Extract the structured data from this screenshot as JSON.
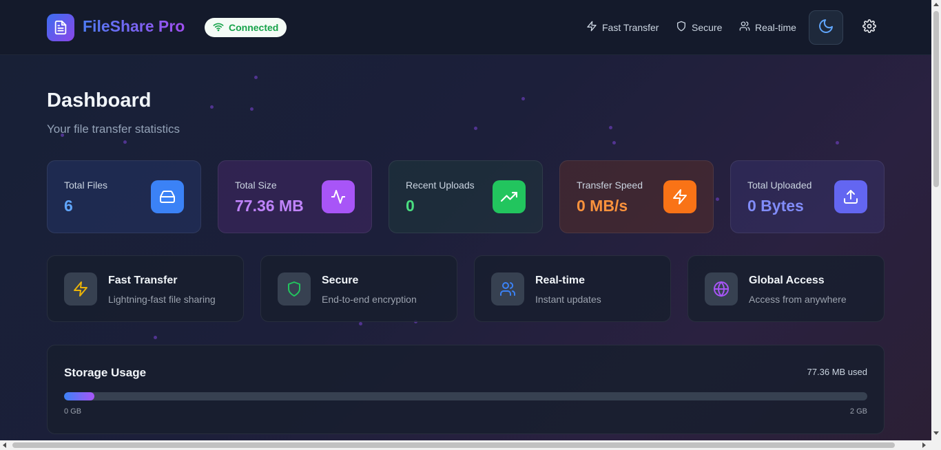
{
  "header": {
    "app_name": "FileShare Pro",
    "status": "Connected",
    "nav": [
      {
        "label": "Fast Transfer",
        "icon": "zap-icon"
      },
      {
        "label": "Secure",
        "icon": "shield-icon"
      },
      {
        "label": "Real-time",
        "icon": "users-icon"
      }
    ],
    "theme_icon": "moon-icon",
    "settings_icon": "gear-icon"
  },
  "page": {
    "title": "Dashboard",
    "subtitle": "Your file transfer statistics"
  },
  "stats": [
    {
      "label": "Total Files",
      "value": "6",
      "color": "#60a5fa",
      "icon": "hard-drive-icon"
    },
    {
      "label": "Total Size",
      "value": "77.36 MB",
      "color": "#c084fc",
      "icon": "activity-icon"
    },
    {
      "label": "Recent Uploads",
      "value": "0",
      "color": "#4ade80",
      "icon": "trending-up-icon"
    },
    {
      "label": "Transfer Speed",
      "value": "0 MB/s",
      "color": "#fb923c",
      "icon": "zap-icon"
    },
    {
      "label": "Total Uploaded",
      "value": "0 Bytes",
      "color": "#818cf8",
      "icon": "upload-icon"
    }
  ],
  "features": [
    {
      "title": "Fast Transfer",
      "subtitle": "Lightning-fast file sharing",
      "icon": "zap-icon"
    },
    {
      "title": "Secure",
      "subtitle": "End-to-end encryption",
      "icon": "shield-icon"
    },
    {
      "title": "Real-time",
      "subtitle": "Instant updates",
      "icon": "users-icon"
    },
    {
      "title": "Global Access",
      "subtitle": "Access from anywhere",
      "icon": "globe-icon"
    }
  ],
  "storage": {
    "title": "Storage Usage",
    "used_label": "77.36 MB used",
    "min_label": "0 GB",
    "max_label": "2 GB",
    "fill_fraction": 0.038
  }
}
